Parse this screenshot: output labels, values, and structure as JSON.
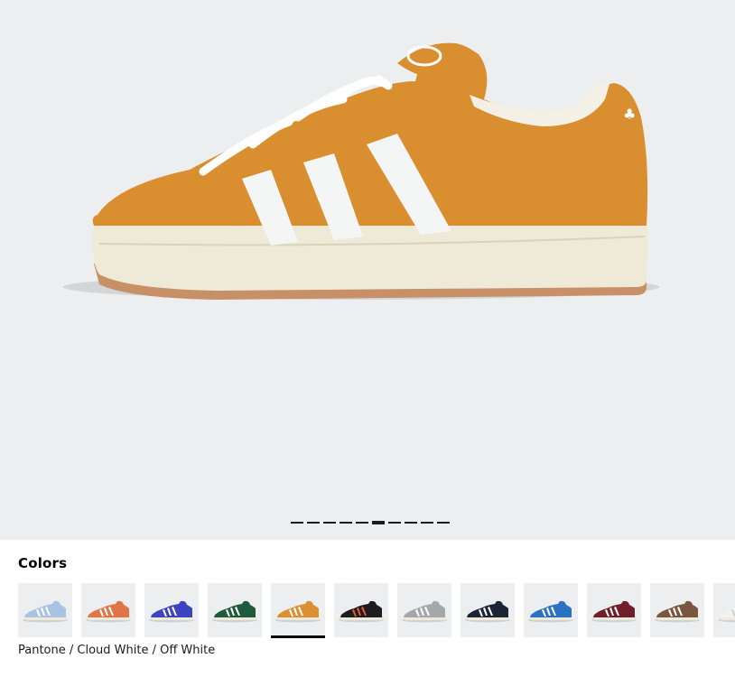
{
  "gallery": {
    "image": "shoe-side-view",
    "slide_count": 10,
    "active_slide": 6
  },
  "colors": {
    "title": "Colors",
    "selected_name": "Pantone / Cloud White / Off White",
    "swatches": [
      {
        "name": "light-blue",
        "upper": "#a9c3e4",
        "stripe": "#ffffff"
      },
      {
        "name": "orange",
        "upper": "#e07548",
        "stripe": "#ffffff"
      },
      {
        "name": "royal-blue",
        "upper": "#3e43c0",
        "stripe": "#ffffff"
      },
      {
        "name": "dark-green",
        "upper": "#1f5a3d",
        "stripe": "#ffffff"
      },
      {
        "name": "pantone-orange",
        "upper": "#dc9032",
        "stripe": "#ffffff"
      },
      {
        "name": "black-multi",
        "upper": "#1d1d1f",
        "stripe": "#e85a3a"
      },
      {
        "name": "grey",
        "upper": "#a5a8ab",
        "stripe": "#ffffff"
      },
      {
        "name": "navy",
        "upper": "#1c2436",
        "stripe": "#ffffff"
      },
      {
        "name": "blue",
        "upper": "#2c72c4",
        "stripe": "#ffffff"
      },
      {
        "name": "burgundy",
        "upper": "#6e1f2a",
        "stripe": "#ffffff"
      },
      {
        "name": "brown",
        "upper": "#7a5540",
        "stripe": "#ffffff"
      },
      {
        "name": "white",
        "upper": "#f2f2f2",
        "stripe": "#d0d0d0"
      }
    ],
    "selected_index": 4
  }
}
